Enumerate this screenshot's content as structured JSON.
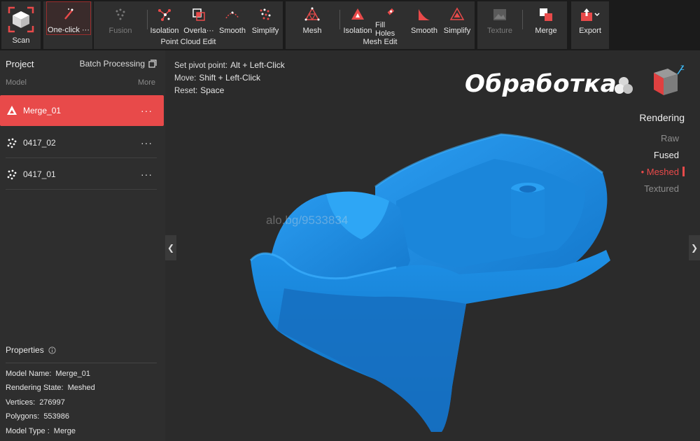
{
  "toolbar": {
    "scan": "Scan",
    "one_click": "One-click ···",
    "point_cloud": {
      "label": "Point Cloud Edit",
      "fusion": "Fusion",
      "isolation": "Isolation",
      "overlap": "Overla···",
      "smooth": "Smooth",
      "simplify": "Simplify"
    },
    "mesh_edit": {
      "label": "Mesh Edit",
      "mesh": "Mesh",
      "isolation": "Isolation",
      "fill_holes": "Fill Holes",
      "smooth": "Smooth",
      "simplify": "Simplify"
    },
    "texture": "Texture",
    "merge": "Merge",
    "export": "Export"
  },
  "sidebar": {
    "title": "Project",
    "batch": "Batch Processing",
    "model_header": "Model",
    "more": "More",
    "models": [
      {
        "name": "Merge_01",
        "dots": "···"
      },
      {
        "name": "0417_02",
        "dots": "···"
      },
      {
        "name": "0417_01",
        "dots": "···"
      }
    ],
    "properties": {
      "title": "Properties",
      "model_name_k": "Model Name:",
      "model_name_v": "Merge_01",
      "rendering_state_k": "Rendering State:",
      "rendering_state_v": "Meshed",
      "vertices_k": "Vertices:",
      "vertices_v": "276997",
      "polygons_k": "Polygons:",
      "polygons_v": "553986",
      "model_type_k": "Model Type :",
      "model_type_v": "Merge"
    }
  },
  "viewport": {
    "hints": [
      {
        "k": "Set pivot point:",
        "v": "Alt + Left-Click"
      },
      {
        "k": "Move:",
        "v": "Shift + Left-Click"
      },
      {
        "k": "Reset:",
        "v": "Space"
      }
    ],
    "overlay_title": "Обработка",
    "watermark": "alo.bg/9533834",
    "axis_z": "Z",
    "rendering": {
      "title": "Rendering",
      "raw": "Raw",
      "fused": "Fused",
      "meshed": "• Meshed",
      "textured": "Textured"
    }
  },
  "colors": {
    "accent": "#e84a4a",
    "model": "#1f8de0"
  }
}
